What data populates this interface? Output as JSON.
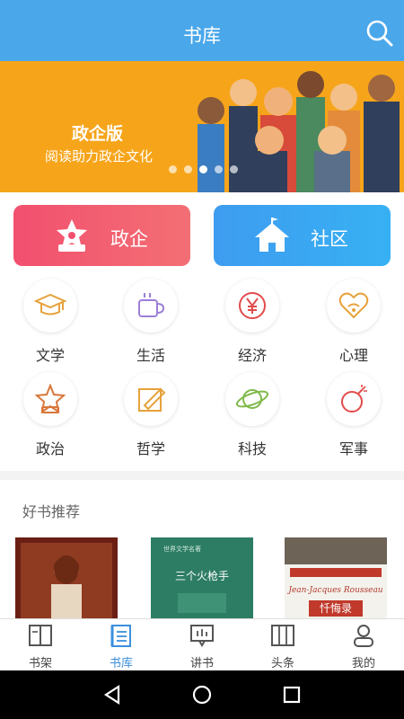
{
  "header": {
    "title": "书库"
  },
  "banner": {
    "title": "政企版",
    "subtitle": "阅读助力政企文化",
    "dots": 5,
    "active_dot": 2
  },
  "quick_actions": [
    {
      "label": "政企",
      "icon": "star-house-icon"
    },
    {
      "label": "社区",
      "icon": "home-flag-icon"
    }
  ],
  "categories": [
    {
      "label": "文学",
      "icon": "graduation-cap-icon"
    },
    {
      "label": "生活",
      "icon": "coffee-cup-icon"
    },
    {
      "label": "经济",
      "icon": "yen-icon"
    },
    {
      "label": "心理",
      "icon": "heart-wifi-icon"
    },
    {
      "label": "政治",
      "icon": "star-badge-icon"
    },
    {
      "label": "哲学",
      "icon": "pencil-square-icon"
    },
    {
      "label": "科技",
      "icon": "planet-icon"
    },
    {
      "label": "军事",
      "icon": "bomb-icon"
    }
  ],
  "recommend": {
    "title": "好书推荐",
    "books": [
      {
        "title": ""
      },
      {
        "title": "三个火枪手"
      },
      {
        "title": "忏悔录",
        "author": "Jean-Jacques Rousseau"
      }
    ]
  },
  "tabs": [
    {
      "label": "书架",
      "icon": "bookshelf-icon"
    },
    {
      "label": "书库",
      "icon": "library-icon",
      "active": true
    },
    {
      "label": "讲书",
      "icon": "speech-icon"
    },
    {
      "label": "头条",
      "icon": "headline-icon"
    },
    {
      "label": "我的",
      "icon": "profile-icon"
    }
  ],
  "colors": {
    "primary": "#4aa7ea",
    "banner": "#f6a51b",
    "zhengqi": "#f2506f",
    "shequ": "#3e9cf0",
    "tab_active": "#3b8fdc"
  }
}
